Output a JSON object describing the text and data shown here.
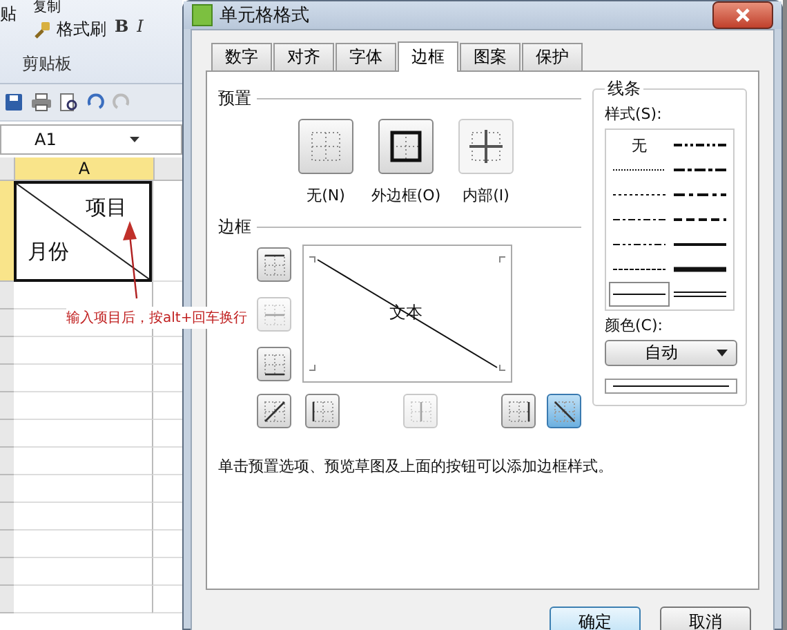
{
  "spreadsheet": {
    "ribbon": {
      "paste": "贴",
      "copy": "复制",
      "format_painter": "格式刷",
      "group": "剪贴板",
      "bold": "B",
      "italic": "I"
    },
    "name_box": "A1",
    "column": "A",
    "cell_lines": [
      "项目",
      "月份"
    ]
  },
  "annotation": "输入项目后，按alt+回车换行",
  "dialog": {
    "title": "单元格格式",
    "tabs": [
      {
        "label": "数字",
        "selected": false
      },
      {
        "label": "对齐",
        "selected": false
      },
      {
        "label": "字体",
        "selected": false
      },
      {
        "label": "边框",
        "selected": true
      },
      {
        "label": "图案",
        "selected": false
      },
      {
        "label": "保护",
        "selected": false
      }
    ],
    "presets_title": "预置",
    "presets": [
      {
        "label": "无(N)",
        "kind": "none",
        "disabled": false
      },
      {
        "label": "外边框(O)",
        "kind": "outline",
        "disabled": false
      },
      {
        "label": "内部(I)",
        "kind": "inside",
        "disabled": true
      }
    ],
    "border_title": "边框",
    "border_buttons": [
      {
        "kind": "top",
        "selected": false,
        "disabled": false
      },
      {
        "kind": "middle-h",
        "selected": false,
        "disabled": true
      },
      {
        "kind": "bottom",
        "selected": false,
        "disabled": false
      },
      {
        "kind": "diag-up",
        "selected": false,
        "disabled": false
      },
      {
        "kind": "left",
        "selected": false,
        "disabled": false
      },
      {
        "kind": "middle-v",
        "selected": false,
        "disabled": true
      },
      {
        "kind": "right",
        "selected": false,
        "disabled": false
      },
      {
        "kind": "diag-down",
        "selected": true,
        "disabled": false
      }
    ],
    "preview_text": "文本",
    "line_group": {
      "title": "线条",
      "style_label": "样式(S):",
      "styles": [
        {
          "kind": "none",
          "label": "无",
          "selected": false
        },
        {
          "kind": "hair",
          "selected": false
        },
        {
          "kind": "dotted",
          "selected": false
        },
        {
          "kind": "dash-dot",
          "selected": false
        },
        {
          "kind": "dash-dot-dot",
          "selected": false
        },
        {
          "kind": "dashed",
          "selected": false
        },
        {
          "kind": "thin",
          "selected": true
        },
        {
          "kind": "medium-dash-dot-dot",
          "selected": false
        },
        {
          "kind": "slant-dash-dot",
          "selected": false
        },
        {
          "kind": "medium-dash-dot",
          "selected": false
        },
        {
          "kind": "medium-dashed",
          "selected": false
        },
        {
          "kind": "medium",
          "selected": false
        },
        {
          "kind": "thick",
          "selected": false
        },
        {
          "kind": "double",
          "selected": false
        }
      ],
      "color_label": "颜色(C):",
      "color_choice": "自动"
    },
    "hint": "单击预置选项、预览草图及上面的按钮可以添加边框样式。",
    "buttons": [
      {
        "label": "确定",
        "default": true
      },
      {
        "label": "取消",
        "default": false
      }
    ]
  }
}
